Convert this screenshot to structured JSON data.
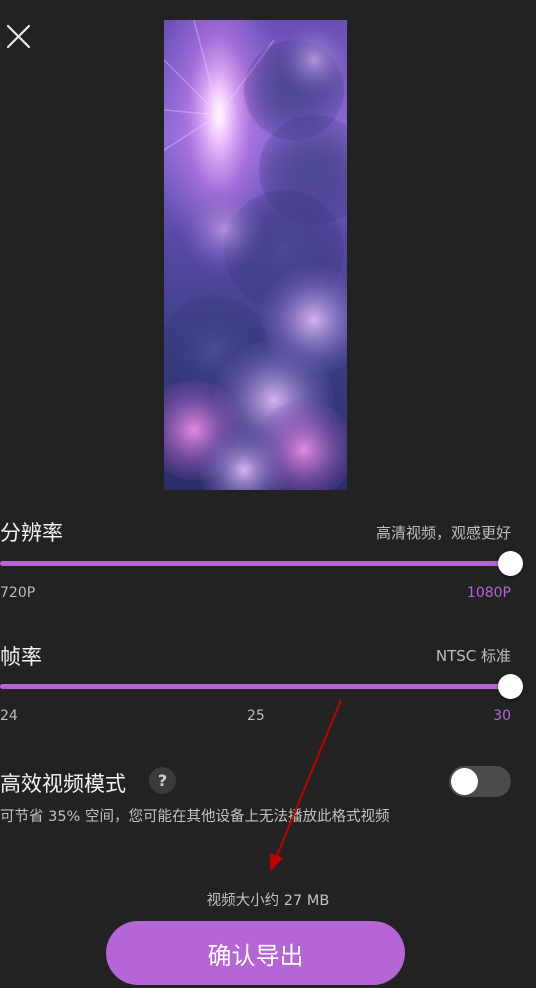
{
  "colors": {
    "accent": "#b565d6",
    "track": "#b565d6",
    "background": "#222222",
    "annotation_arrow": "#c00000"
  },
  "header": {
    "close_icon": "close-icon"
  },
  "preview": {
    "image": "purple-cloud-sky"
  },
  "resolution": {
    "title": "分辨率",
    "hint": "高清视频，观感更好",
    "ticks": [
      "720P",
      "1080P"
    ],
    "selected": "1080P",
    "value_fraction": 1.0
  },
  "framerate": {
    "title": "帧率",
    "hint": "NTSC 标准",
    "ticks": [
      "24",
      "25",
      "30"
    ],
    "selected": "30",
    "value_fraction": 1.0
  },
  "hevc": {
    "title": "高效视频模式",
    "help_icon": "question-icon",
    "help_text": "?",
    "enabled": false,
    "description": "可节省 35% 空间，您可能在其他设备上无法播放此格式视频"
  },
  "footer": {
    "size_text": "视频大小约 27 MB",
    "export_label": "确认导出"
  }
}
